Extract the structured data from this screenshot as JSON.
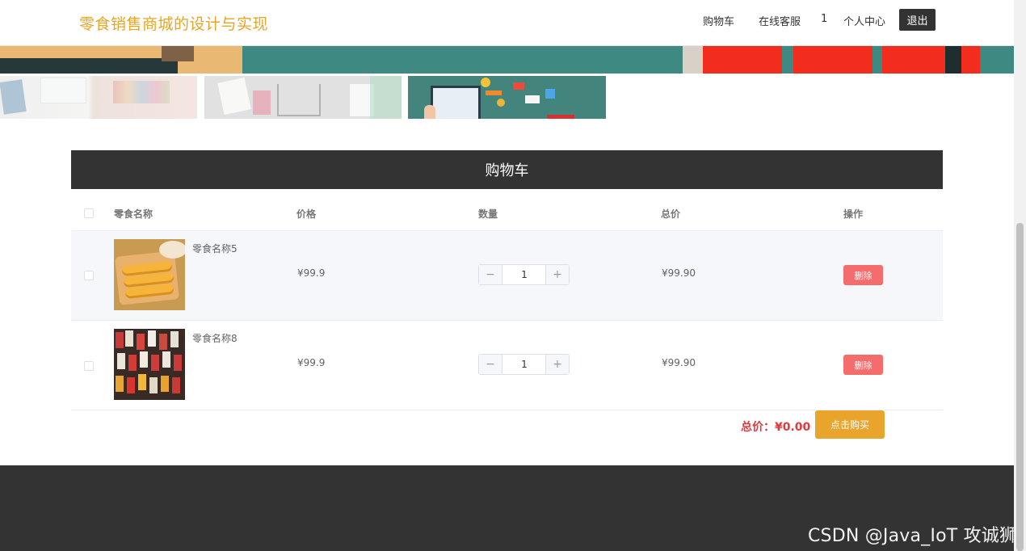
{
  "header": {
    "site_title": "零食销售商城的设计与实现",
    "nav": {
      "cart": "购物车",
      "customer_service": "在线客服",
      "user_id": "1",
      "profile": "个人中心",
      "logout": "退出"
    }
  },
  "cart": {
    "title": "购物车",
    "columns": {
      "name": "零食名称",
      "price": "价格",
      "quantity": "数量",
      "total": "总价",
      "action": "操作"
    },
    "items": [
      {
        "name": "零食名称5",
        "price": "¥99.9",
        "quantity": "1",
        "subtotal": "¥99.90",
        "delete_label": "删除"
      },
      {
        "name": "零食名称8",
        "price": "¥99.9",
        "quantity": "1",
        "subtotal": "¥99.90",
        "delete_label": "删除"
      }
    ],
    "total_label": "总价：",
    "total_value": "¥0.00",
    "buy_label": "点击购买"
  },
  "watermark": "CSDN @Java_IoT 攻诚狮",
  "colors": {
    "accent_title": "#e6a525",
    "header_bar": "#333333",
    "delete": "#f56c6c",
    "buy": "#e9a42c",
    "total_text": "#e4393c"
  }
}
